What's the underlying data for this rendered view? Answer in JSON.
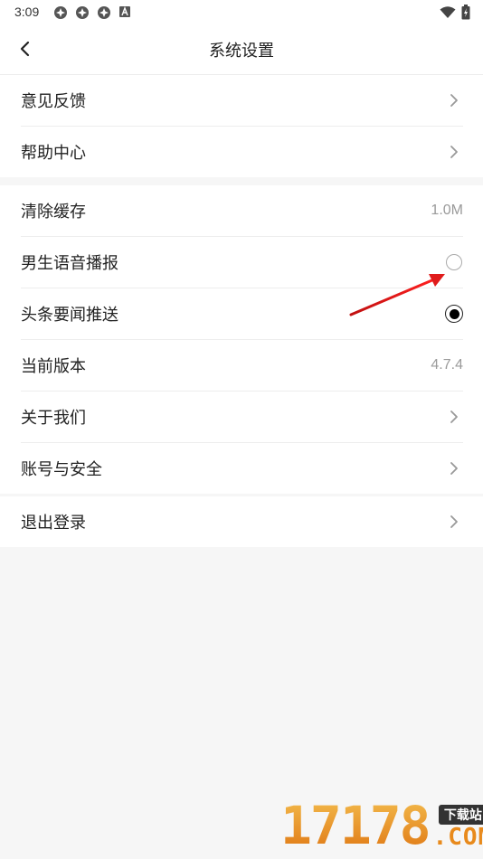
{
  "statusbar": {
    "time": "3:09",
    "icons": [
      "app-icon",
      "app-icon",
      "app-icon",
      "notification-a-icon"
    ],
    "right_icons": [
      "wifi-icon",
      "battery-charging-icon"
    ]
  },
  "header": {
    "back_icon": "chevron-left-icon",
    "title": "系统设置"
  },
  "groups": [
    {
      "items": [
        {
          "label": "意见反馈",
          "accessory": "chevron-right-icon"
        },
        {
          "label": "帮助中心",
          "accessory": "chevron-right-icon"
        }
      ]
    },
    {
      "items": [
        {
          "label": "清除缓存",
          "value": "1.0M"
        },
        {
          "label": "男生语音播报",
          "accessory": "radio",
          "selected": false
        },
        {
          "label": "头条要闻推送",
          "accessory": "radio",
          "selected": true
        },
        {
          "label": "当前版本",
          "value": "4.7.4"
        },
        {
          "label": "关于我们",
          "accessory": "chevron-right-icon"
        },
        {
          "label": "账号与安全",
          "accessory": "chevron-right-icon"
        }
      ]
    },
    {
      "items": [
        {
          "label": "退出登录",
          "accessory": "chevron-right-icon"
        }
      ]
    }
  ],
  "annotation": {
    "type": "red-arrow",
    "color": "#e01b1b",
    "points_to": "男生语音播报 radio"
  },
  "watermark": {
    "number": "17178",
    "tag": "下载站",
    "suffix": ".COM"
  },
  "colors": {
    "background": "#f6f6f6",
    "row_background": "#ffffff",
    "divider": "#ededed",
    "secondary_text": "#9a9a9a",
    "watermark_orange": "#e88a1c"
  }
}
